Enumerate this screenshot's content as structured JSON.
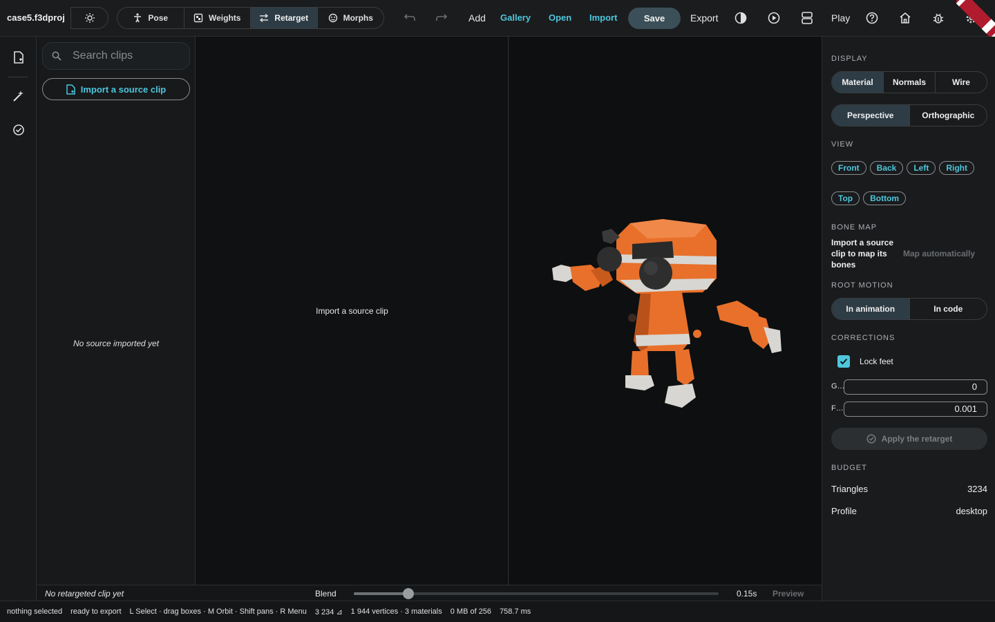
{
  "app": {
    "project_name": "case5.f3dproj"
  },
  "toolbar": {
    "modes": [
      {
        "label": "Pose",
        "icon": "pose-icon"
      },
      {
        "label": "Weights",
        "icon": "weights-icon"
      },
      {
        "label": "Retarget",
        "icon": "retarget-icon",
        "active": true
      },
      {
        "label": "Morphs",
        "icon": "morphs-icon"
      }
    ],
    "add_label": "Add",
    "gallery_label": "Gallery",
    "open_label": "Open",
    "import_label": "Import",
    "save_label": "Save",
    "export_label": "Export",
    "play_label": "Play",
    "accent_color": "#4fc6dc"
  },
  "clips": {
    "search_placeholder": "Search clips",
    "import_button": "Import a source clip",
    "empty_note": "No source imported yet"
  },
  "center": {
    "prompt": "Import a source clip"
  },
  "timeline": {
    "status": "No retargeted clip yet",
    "blend_label": "Blend",
    "blend_value": 0.15,
    "time": "0.15s",
    "preview_label": "Preview"
  },
  "status_bar": {
    "selection": "nothing selected",
    "export_state": "ready to export",
    "hints": "L Select · drag boxes · M Orbit · Shift pans · R Menu",
    "triangles": "3 234 ⊿",
    "mesh": "1 944 vertices · 3 materials",
    "memory": "0 MB of 256",
    "frame_time": "758.7 ms"
  },
  "inspector": {
    "display_title": "DISPLAY",
    "shading": [
      "Material",
      "Normals",
      "Wire"
    ],
    "projection": [
      "Perspective",
      "Orthographic"
    ],
    "view_title": "VIEW",
    "views_row1": [
      "Front",
      "Back",
      "Left",
      "Right"
    ],
    "views_row2": [
      "Top",
      "Bottom"
    ],
    "bone_map_title": "BONE MAP",
    "bone_map_text": "Import a source clip to map its bones",
    "bone_map_action": "Map automatically",
    "root_motion_title": "ROOT MOTION",
    "root_motion": [
      "In animation",
      "In code"
    ],
    "corrections_title": "CORRECTIONS",
    "lock_feet_label": "Lock feet",
    "lock_feet_checked": true,
    "g_label": "G…",
    "g_value": "0",
    "f_label": "F…",
    "f_value": "0.001",
    "apply_label": "Apply the retarget",
    "budget_title": "BUDGET",
    "triangles_label": "Triangles",
    "triangles_value": "3234",
    "profile_label": "Profile",
    "profile_value": "desktop"
  }
}
